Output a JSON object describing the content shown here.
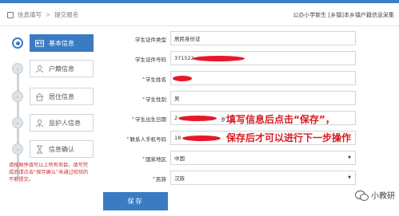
{
  "breadcrumb": {
    "item1": "信息填写",
    "separator": ">",
    "item2": "提交报名"
  },
  "header": {
    "right_text": "公办小学新生 [乡镇]本乡镇户籍信息采集"
  },
  "sidebar": {
    "steps": [
      {
        "label": "基本信息",
        "icon": "id-card-icon",
        "active": true
      },
      {
        "label": "户籍信息",
        "icon": "person-icon",
        "active": false
      },
      {
        "label": "居住信息",
        "icon": "house-icon",
        "active": false
      },
      {
        "label": "监护人信息",
        "icon": "guardian-icon",
        "active": false
      },
      {
        "label": "信息确认",
        "icon": "hourglass-icon",
        "active": false
      }
    ],
    "note": "请按顺序填写以上所有项目。填写完成后请点击“保存确认”未通过校验的不能提交。"
  },
  "form": {
    "fields": [
      {
        "label": "学生证件类型",
        "required": false,
        "value": "居民身份证",
        "type": "text"
      },
      {
        "label": "学生证件号码",
        "required": false,
        "value": "371522",
        "type": "text"
      },
      {
        "label": "学生姓名",
        "required": true,
        "value": "",
        "type": "text"
      },
      {
        "label": "学生性别",
        "required": true,
        "value": "男",
        "type": "text"
      },
      {
        "label": "学生出生日期",
        "required": true,
        "value": "2",
        "suffix": "岁",
        "type": "text"
      },
      {
        "label": "联系人手机号码",
        "required": true,
        "value": "18",
        "type": "text"
      },
      {
        "label": "国家地区",
        "required": true,
        "value": "中国",
        "type": "select"
      },
      {
        "label": "民族",
        "required": true,
        "value": "汉族",
        "type": "select"
      }
    ],
    "save_label": "保存"
  },
  "annotation": {
    "line1": "填写信息后点击“保存”，",
    "line2": "保存后才可以进行下一步操作"
  },
  "watermark": {
    "text": "小教研"
  },
  "colors": {
    "primary": "#3a7cc4",
    "annotation": "#d81b22",
    "redaction": "#e8182a"
  }
}
